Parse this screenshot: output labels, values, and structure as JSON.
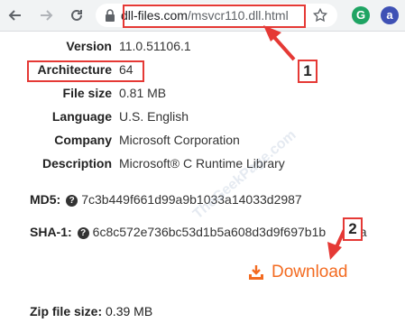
{
  "browser": {
    "url_domain": "dll-files.com",
    "url_path": "/msvcr110.dll.html",
    "extension_g": "G",
    "extension_a": "a"
  },
  "file_info": [
    {
      "label": "Version",
      "value": "11.0.51106.1"
    },
    {
      "label": "Architecture",
      "value": "64"
    },
    {
      "label": "File size",
      "value": "0.81 MB"
    },
    {
      "label": "Language",
      "value": "U.S. English"
    },
    {
      "label": "Company",
      "value": "Microsoft Corporation"
    },
    {
      "label": "Description",
      "value": "Microsoft® C Runtime Library"
    }
  ],
  "hashes": {
    "md5_label": "MD5:",
    "md5_value": "7c3b449f661d99a9b1033a14033d2987",
    "sha1_label": "SHA-1:",
    "sha1_value": "6c8c572e736bc53d1b5a608d3d9f697b1b",
    "sha1_tail": "1da",
    "help_glyph": "?"
  },
  "download": {
    "label": "Download",
    "color": "#f36b21"
  },
  "zip": {
    "label": "Zip file size:",
    "value": "0.39 MB"
  },
  "annotations": {
    "step1": "1",
    "step2": "2",
    "color": "#e53935"
  },
  "watermark": "TheGeekPage.com"
}
